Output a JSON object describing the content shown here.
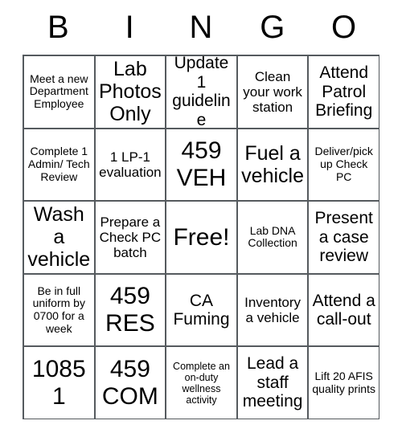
{
  "card": {
    "headers": [
      "B",
      "I",
      "N",
      "G",
      "O"
    ],
    "colors": {
      "background": "#ffffff",
      "text": "#000000",
      "grid_line": "#555a5e"
    },
    "rows": [
      [
        {
          "text": "Meet a new Department Employee",
          "size": "sm"
        },
        {
          "text": "Lab Photos Only",
          "size": "xl"
        },
        {
          "text": "Update 1 guideline",
          "size": "lg"
        },
        {
          "text": "Clean your work station",
          "size": "md"
        },
        {
          "text": "Attend Patrol Briefing",
          "size": "lg"
        }
      ],
      [
        {
          "text": "Complete 1 Admin/ Tech Review",
          "size": "sm"
        },
        {
          "text": "1 LP-1 evaluation",
          "size": "md"
        },
        {
          "text": "459 VEH",
          "size": "xxl"
        },
        {
          "text": "Fuel a vehicle",
          "size": "xl"
        },
        {
          "text": "Deliver/pick up Check PC",
          "size": "sm"
        }
      ],
      [
        {
          "text": "Wash a vehicle",
          "size": "xl"
        },
        {
          "text": "Prepare a Check PC batch",
          "size": "md"
        },
        {
          "text": "Free!",
          "size": "xxl"
        },
        {
          "text": "Lab DNA Collection",
          "size": "sm"
        },
        {
          "text": "Present a case review",
          "size": "lg"
        }
      ],
      [
        {
          "text": "Be in full uniform by 0700 for a week",
          "size": "sm"
        },
        {
          "text": "459 RES",
          "size": "xxl"
        },
        {
          "text": "CA Fuming",
          "size": "lg"
        },
        {
          "text": "Inventory a vehicle",
          "size": "md"
        },
        {
          "text": "Attend a call-out",
          "size": "lg"
        }
      ],
      [
        {
          "text": "10851",
          "size": "xxl"
        },
        {
          "text": "459 COM",
          "size": "xxl"
        },
        {
          "text": "Complete an on-duty wellness activity",
          "size": "xs"
        },
        {
          "text": "Lead a staff meeting",
          "size": "lg"
        },
        {
          "text": "Lift 20 AFIS quality prints",
          "size": "sm"
        }
      ]
    ]
  }
}
